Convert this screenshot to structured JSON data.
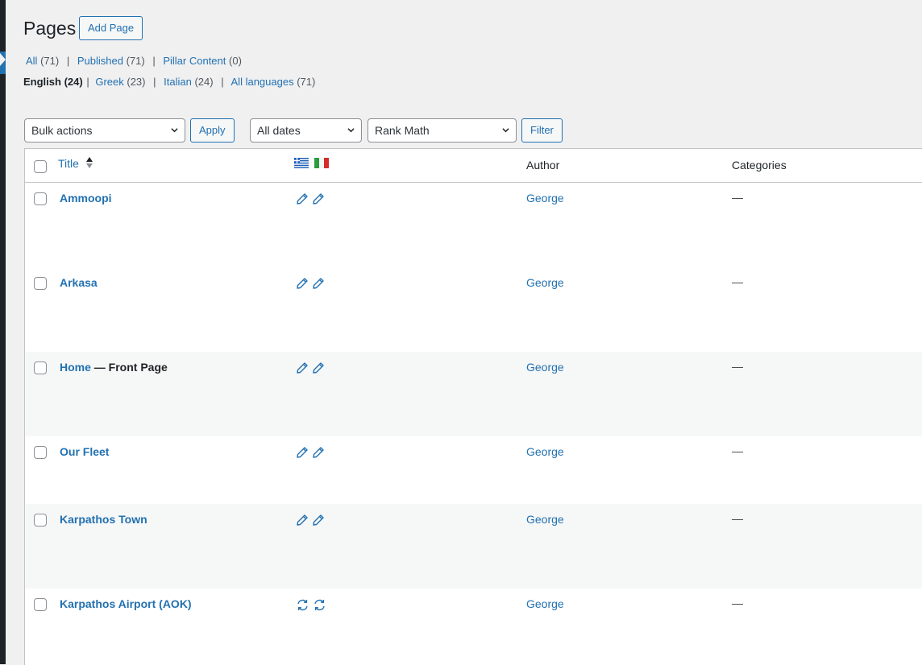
{
  "page": {
    "title": "Pages",
    "add_label": "Add Page"
  },
  "status_filters": [
    {
      "label": "All",
      "count": "(71)"
    },
    {
      "label": "Published",
      "count": "(71)"
    },
    {
      "label": "Pillar Content",
      "count": "(0)"
    }
  ],
  "language_filters": {
    "current": {
      "label": "English",
      "count": "(24)"
    },
    "items": [
      {
        "label": "Greek",
        "count": "(23)"
      },
      {
        "label": "Italian",
        "count": "(24)"
      },
      {
        "label": "All languages",
        "count": "(71)"
      }
    ]
  },
  "toolbar": {
    "bulk_actions": "Bulk actions",
    "apply": "Apply",
    "dates": "All dates",
    "seo": "Rank Math",
    "filter": "Filter"
  },
  "table": {
    "headers": {
      "title": "Title",
      "author": "Author",
      "categories": "Categories"
    },
    "flag_icons": [
      "greek-flag-icon",
      "italian-flag-icon"
    ],
    "rows": [
      {
        "title": "Ammoopi",
        "state": "",
        "icon": "pencil-icon",
        "author": "George",
        "categories": "—"
      },
      {
        "title": "Arkasa",
        "state": "",
        "icon": "pencil-icon",
        "author": "George",
        "categories": "—"
      },
      {
        "title": "Home",
        "state": " — Front Page",
        "icon": "pencil-icon",
        "author": "George",
        "categories": "—"
      },
      {
        "title": "Our Fleet",
        "state": "",
        "icon": "pencil-icon",
        "author": "George",
        "categories": "—"
      },
      {
        "title": "Karpathos Town",
        "state": "",
        "icon": "pencil-icon",
        "author": "George",
        "categories": "—"
      },
      {
        "title": "Karpathos Airport (AOK)",
        "state": "",
        "icon": "sync-icon",
        "author": "George",
        "categories": "—"
      }
    ]
  },
  "colors": {
    "link": "#2271b1",
    "background": "#f0f0f1",
    "alt_row": "#f6f7f7"
  }
}
